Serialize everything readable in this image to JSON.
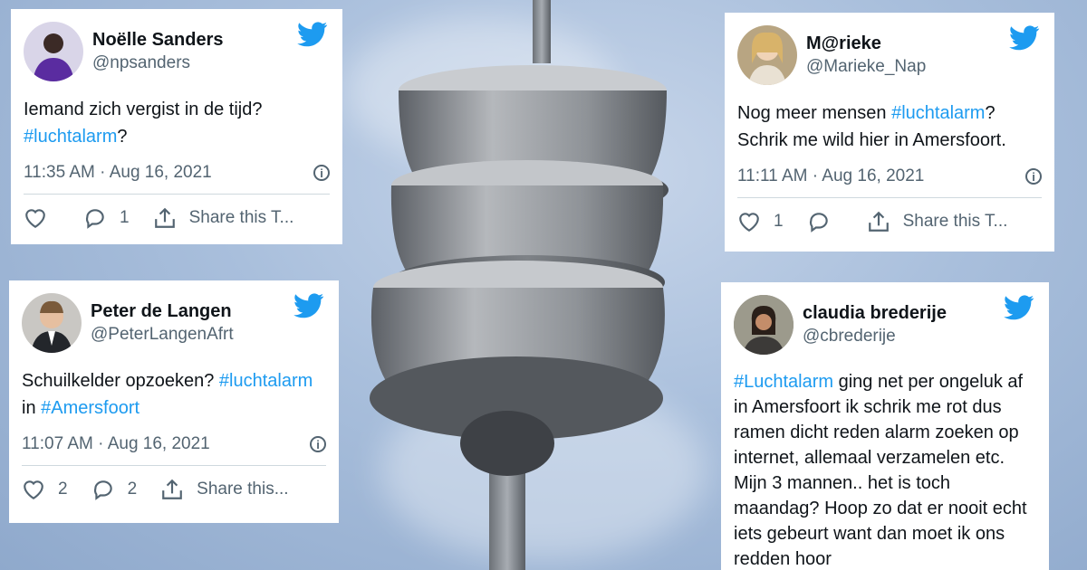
{
  "tweets": [
    {
      "name": "Noëlle Sanders",
      "handle": "@npsanders",
      "body_parts": [
        "Iemand zich vergist in de tijd? ",
        "#luchtalarm",
        "?"
      ],
      "time": "11:35 AM · Aug 16, 2021",
      "likes": "",
      "replies": "1",
      "share_label": "Share this T..."
    },
    {
      "name": "M@rieke",
      "handle": "@Marieke_Nap",
      "body_parts": [
        "Nog meer mensen ",
        "#luchtalarm",
        "? Schrik me wild hier in Amersfoort."
      ],
      "time": "11:11 AM · Aug 16, 2021",
      "likes": "1",
      "replies": "",
      "share_label": "Share this T..."
    },
    {
      "name": "Peter de Langen",
      "handle": "@PeterLangenAfrt",
      "body_parts": [
        "Schuilkelder opzoeken? ",
        "#luchtalarm",
        " in ",
        "#Amersfoort"
      ],
      "time": "11:07 AM · Aug 16, 2021",
      "likes": "2",
      "replies": "2",
      "share_label": "Share this..."
    },
    {
      "name": "claudia brederije",
      "handle": "@cbrederije",
      "body_parts": [
        "#Luchtalarm",
        " ging net per ongeluk af in Amersfoort ik schrik me rot dus ramen dicht reden alarm zoeken op internet, allemaal verzamelen etc. Mijn 3 mannen.. het is toch maandag? Hoop zo dat er nooit echt iets gebeurt want dan moet ik ons redden hoor"
      ]
    }
  ],
  "icons": {
    "bird": "twitter-bird-icon",
    "like": "heart-icon",
    "reply": "reply-bubble-icon",
    "share": "share-upload-icon",
    "info": "info-icon"
  },
  "colors": {
    "link": "#1d9bf0",
    "bird": "#1d9bf0",
    "muted": "#536471"
  }
}
